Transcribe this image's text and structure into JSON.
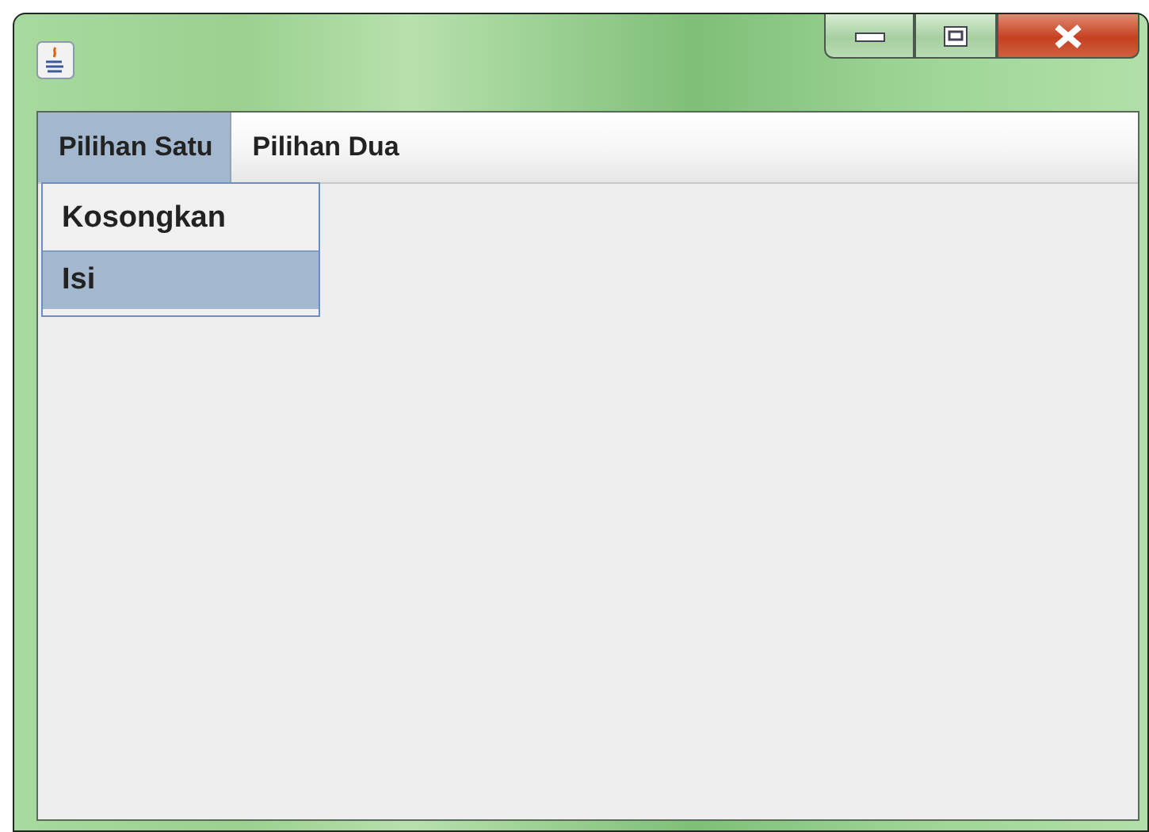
{
  "menu_bar": {
    "menus": [
      {
        "label": "Pilihan Satu",
        "selected": true
      },
      {
        "label": "Pilihan Dua",
        "selected": false
      }
    ]
  },
  "dropdown": {
    "items": [
      {
        "label": "Kosongkan",
        "selected": false
      },
      {
        "label": "Isi",
        "selected": true
      }
    ]
  }
}
